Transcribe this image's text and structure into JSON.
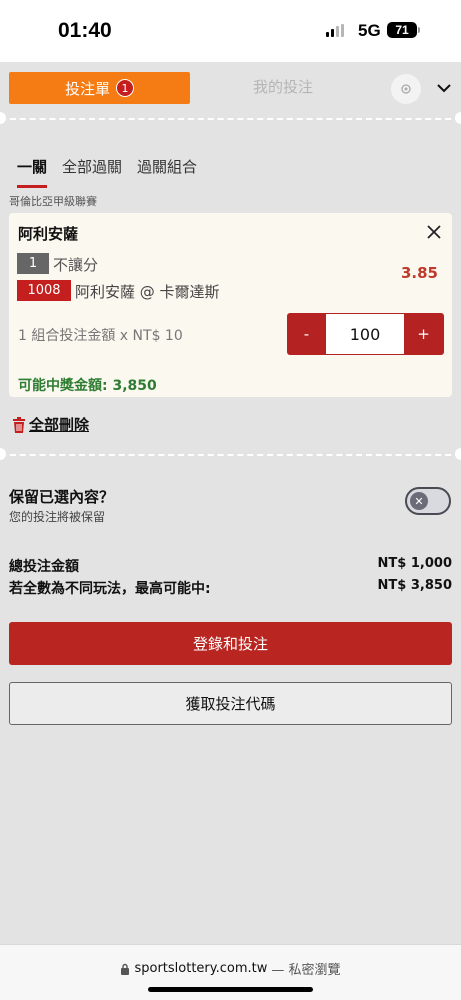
{
  "status_bar": {
    "time": "01:40",
    "network": "5G",
    "battery": "71"
  },
  "header": {
    "tab_betslip": "投注單",
    "betslip_count": "1",
    "tab_my_bets": "我的投注",
    "settings_icon": "settings-icon",
    "collapse_icon": "chevron-down-icon"
  },
  "bet_types": [
    {
      "label": "一關",
      "active": true
    },
    {
      "label": "全部過關",
      "active": false
    },
    {
      "label": "過關組合",
      "active": false
    }
  ],
  "league": "哥倫比亞甲級聯賽",
  "selection": {
    "team": "阿利安薩",
    "market_number": "1",
    "market_name": "不讓分",
    "odds": "3.85",
    "event_number": "1008",
    "event_name": "阿利安薩 @ 卡爾達斯",
    "stake_description": "1 組合投注金額 x NT$ 10",
    "decrement_label": "-",
    "stake_value": "100",
    "increment_label": "+",
    "potential_payout": "可能中獎金額: 3,850"
  },
  "remove_all": "全部刪除",
  "keep_selections": {
    "title": "保留已選內容？",
    "subtitle": "您的投注將被保留",
    "enabled": false
  },
  "summary": {
    "total_label": "總投注金額",
    "total_value": "NT$ 1,000",
    "max_label": "若全數為不同玩法，最高可能中:",
    "max_value": "NT$ 3,850"
  },
  "buttons": {
    "login_and_bet": "登錄和投注",
    "get_bet_code": "獲取投注代碼"
  },
  "browser": {
    "domain": "sportslottery.com.tw",
    "suffix": "— 私密瀏覽"
  },
  "colors": {
    "accent_orange": "#f57c14",
    "brand_red": "#b92621",
    "payout_green": "#2e7d32"
  }
}
